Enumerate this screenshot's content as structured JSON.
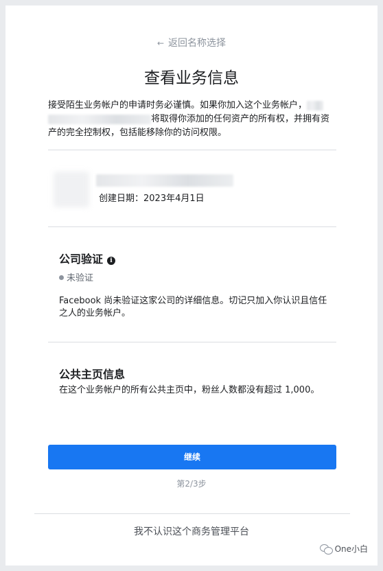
{
  "header": {
    "back_label": "返回名称选择",
    "title": "查看业务信息"
  },
  "warning": {
    "text_part1": "接受陌生业务帐户的申请时务必谨慎。如果你加入这个业务帐户，",
    "text_part2": "将取得你添加的任何资产的所有权，并拥有资产的完全控制权，包括能移除你的访问权限。"
  },
  "business": {
    "created_label": "创建日期：2023年4月1日"
  },
  "verification": {
    "title": "公司验证",
    "info_icon_glyph": "i",
    "status": "未验证",
    "description": "Facebook 尚未验证这家公司的详细信息。切记只加入你认识且信任之人的业务帐户。"
  },
  "public_page": {
    "title": "公共主页信息",
    "description": "在这个业务帐户的所有公共主页中，粉丝人数都没有超过 1,000。"
  },
  "actions": {
    "continue_label": "继续",
    "step_label": "第2/3步",
    "not_recognize_label": "我不认识这个商务管理平台"
  },
  "watermark": {
    "text": "One小白"
  },
  "colors": {
    "primary": "#1877f2",
    "background": "#e9ebee",
    "muted": "#8d949e"
  }
}
